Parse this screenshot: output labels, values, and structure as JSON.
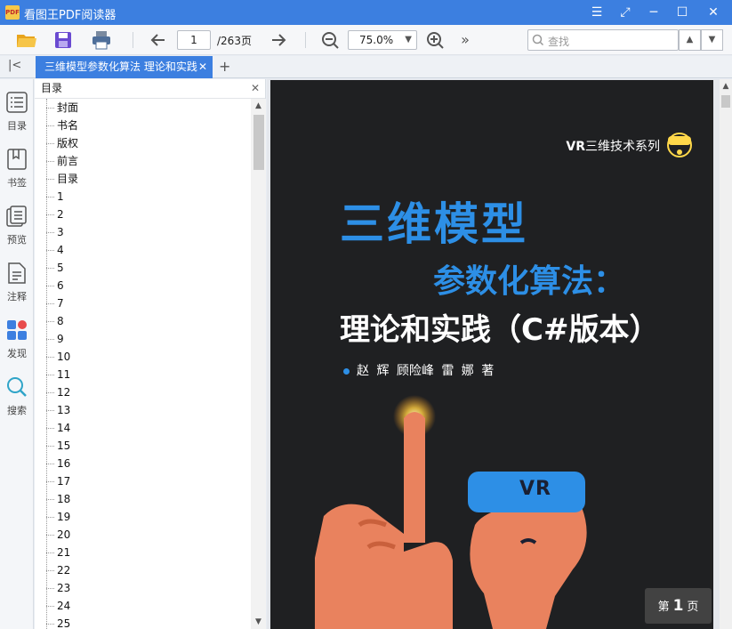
{
  "app": {
    "title": "看图王PDF阅读器",
    "logo_text": "PDF"
  },
  "toolbar": {
    "current_page": "1",
    "total_pages": "/263页",
    "zoom": "75.0%",
    "search_placeholder": "查找"
  },
  "tab": {
    "label": "三维模型参数化算法  理论和实践"
  },
  "rail": [
    {
      "label": "目录",
      "icon": "list-icon"
    },
    {
      "label": "书签",
      "icon": "bookmark-icon"
    },
    {
      "label": "预览",
      "icon": "preview-icon"
    },
    {
      "label": "注释",
      "icon": "note-icon"
    },
    {
      "label": "发现",
      "icon": "discover-icon"
    },
    {
      "label": "搜索",
      "icon": "search-icon"
    }
  ],
  "toc": {
    "title": "目录",
    "items": [
      "封面",
      "书名",
      "版权",
      "前言",
      "目录",
      "1",
      "2",
      "3",
      "4",
      "5",
      "6",
      "7",
      "8",
      "9",
      "10",
      "11",
      "12",
      "13",
      "14",
      "15",
      "16",
      "17",
      "18",
      "19",
      "20",
      "21",
      "22",
      "23",
      "24",
      "25"
    ]
  },
  "cover": {
    "series": "三维技术系列",
    "series_prefix": "VR",
    "title_line1": "三维模型",
    "title_line2": "参数化算法：",
    "title_line3": "理论和实践（C#版本）",
    "authors": "赵 辉  顾险峰  雷 娜  著",
    "vr_text": "VR"
  },
  "page_indicator": {
    "prefix": "第",
    "number": "1",
    "suffix": "页"
  },
  "colors": {
    "accent": "#3c7fe0",
    "cover_blue": "#2d8fe6",
    "cover_bg": "#1f2022",
    "skin": "#e9825e"
  }
}
